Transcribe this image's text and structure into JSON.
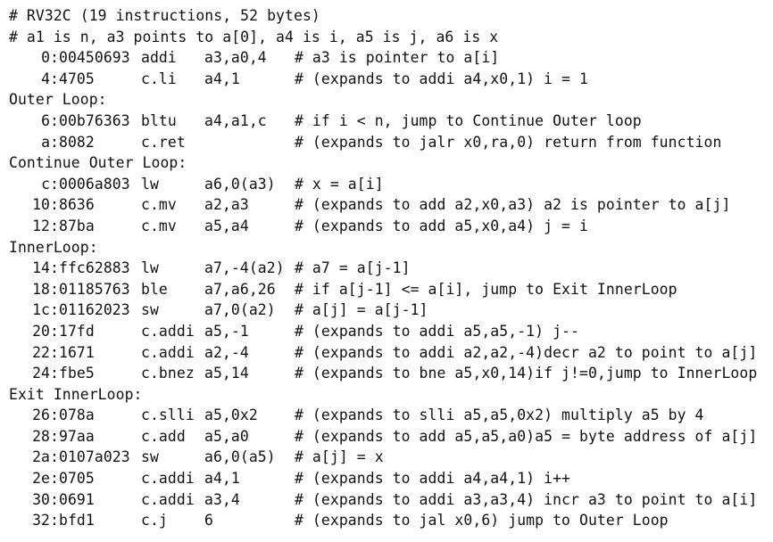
{
  "lines": [
    {
      "type": "header",
      "text": "# RV32C (19 instructions, 52 bytes)"
    },
    {
      "type": "header",
      "text": "# a1 is n, a3 points to a[0], a4 is i, a5 is j, a6 is x"
    },
    {
      "type": "instr",
      "addr": "0:",
      "code": "00450693",
      "op": "addi",
      "args": "a3,a0,4",
      "comment": "# a3 is pointer to a[i]"
    },
    {
      "type": "instr",
      "addr": "4:",
      "code": "4705",
      "op": "c.li",
      "args": "a4,1",
      "comment": "# (expands to addi a4,x0,1) i = 1"
    },
    {
      "type": "label",
      "text": "Outer Loop:"
    },
    {
      "type": "instr",
      "addr": "6:",
      "code": "00b76363",
      "op": "bltu",
      "args": "a4,a1,c",
      "comment": "# if i < n, jump to Continue Outer loop"
    },
    {
      "type": "instr",
      "addr": "a:",
      "code": "8082",
      "op": "c.ret",
      "args": "",
      "comment": "# (expands to jalr x0,ra,0) return from function"
    },
    {
      "type": "label",
      "text": "Continue Outer Loop:"
    },
    {
      "type": "instr",
      "addr": "c:",
      "code": "0006a803",
      "op": "lw",
      "args": "a6,0(a3)",
      "comment": "# x = a[i]"
    },
    {
      "type": "instr",
      "addr": "10:",
      "code": "8636",
      "op": "c.mv",
      "args": "a2,a3",
      "comment": "# (expands to add a2,x0,a3) a2 is pointer to a[j]"
    },
    {
      "type": "instr",
      "addr": "12:",
      "code": "87ba",
      "op": "c.mv",
      "args": "a5,a4",
      "comment": "# (expands to add a5,x0,a4) j = i"
    },
    {
      "type": "label",
      "text": "InnerLoop:"
    },
    {
      "type": "instr",
      "addr": "14:",
      "code": "ffc62883",
      "op": "lw",
      "args": "a7,-4(a2)",
      "comment": "# a7 = a[j-1]"
    },
    {
      "type": "instr",
      "addr": "18:",
      "code": "01185763",
      "op": "ble",
      "args": "a7,a6,26",
      "comment": "# if a[j-1] <= a[i], jump to Exit InnerLoop"
    },
    {
      "type": "instr",
      "addr": "1c:",
      "code": "01162023",
      "op": "sw",
      "args": "a7,0(a2)",
      "comment": "# a[j] = a[j-1]"
    },
    {
      "type": "instr",
      "addr": "20:",
      "code": "17fd",
      "op": "c.addi",
      "args": "a5,-1",
      "comment": "# (expands to addi a5,a5,-1) j--"
    },
    {
      "type": "instr",
      "addr": "22:",
      "code": "1671",
      "op": "c.addi",
      "args": "a2,-4",
      "comment": "# (expands to addi a2,a2,-4)decr a2 to point to a[j]"
    },
    {
      "type": "instr",
      "addr": "24:",
      "code": "fbe5",
      "op": "c.bnez",
      "args": "a5,14",
      "comment": "# (expands to bne a5,x0,14)if j!=0,jump to InnerLoop"
    },
    {
      "type": "label",
      "text": "Exit InnerLoop:"
    },
    {
      "type": "instr",
      "addr": "26:",
      "code": "078a",
      "op": "c.slli",
      "args": "a5,0x2",
      "comment": "# (expands to slli a5,a5,0x2) multiply a5 by 4"
    },
    {
      "type": "instr",
      "addr": "28:",
      "code": "97aa",
      "op": "c.add",
      "args": "a5,a0",
      "comment": "# (expands to add a5,a5,a0)a5 = byte address of a[j]"
    },
    {
      "type": "instr",
      "addr": "2a:",
      "code": "0107a023",
      "op": "sw",
      "args": "a6,0(a5)",
      "comment": "# a[j] = x"
    },
    {
      "type": "instr",
      "addr": "2e:",
      "code": "0705",
      "op": "c.addi",
      "args": "a4,1",
      "comment": "# (expands to addi a4,a4,1) i++"
    },
    {
      "type": "instr",
      "addr": "30:",
      "code": "0691",
      "op": "c.addi",
      "args": "a3,4",
      "comment": "# (expands to addi a3,a3,4) incr a3 to point to a[i]"
    },
    {
      "type": "instr",
      "addr": "32:",
      "code": "bfd1",
      "op": "c.j",
      "args": "6",
      "comment": "# (expands to jal x0,6) jump to Outer Loop"
    }
  ]
}
